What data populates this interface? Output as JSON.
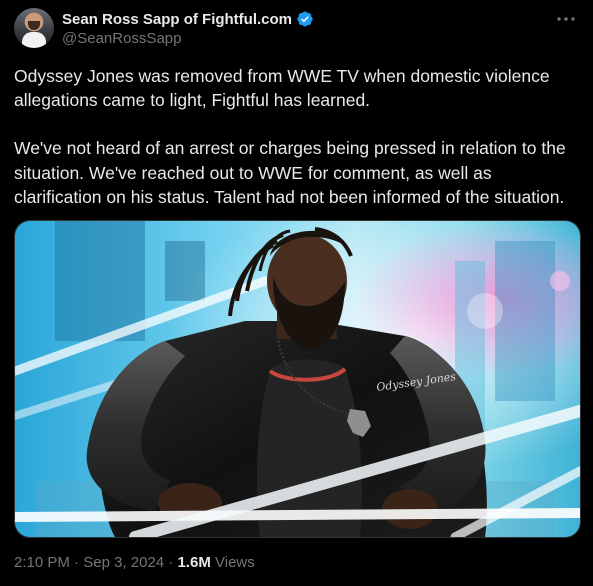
{
  "author": {
    "display_name": "Sean Ross Sapp of Fightful.com",
    "handle": "@SeanRossSapp",
    "verified": true,
    "verified_color": "#1d9bf0"
  },
  "more_icon": "more-horizontal-icon",
  "text": {
    "paragraph_1": "Odyssey Jones was removed from WWE TV when domestic violence allegations came to light, Fightful has learned.",
    "paragraph_2": "We've not heard of an arrest or charges being pressed in relation to the situation. We've reached out to WWE for comment, as well as clarification on his status. Talent had not been informed of the situation."
  },
  "media": {
    "jacket_text": "Odyssey Jones"
  },
  "meta": {
    "time": "2:10 PM",
    "separator": " · ",
    "date": "Sep 3, 2024",
    "views_count": "1.6M",
    "views_label": "Views"
  },
  "colors": {
    "background": "#000000",
    "text_primary": "#e7e9ea",
    "text_secondary": "#71767b",
    "border": "#2f3336"
  }
}
